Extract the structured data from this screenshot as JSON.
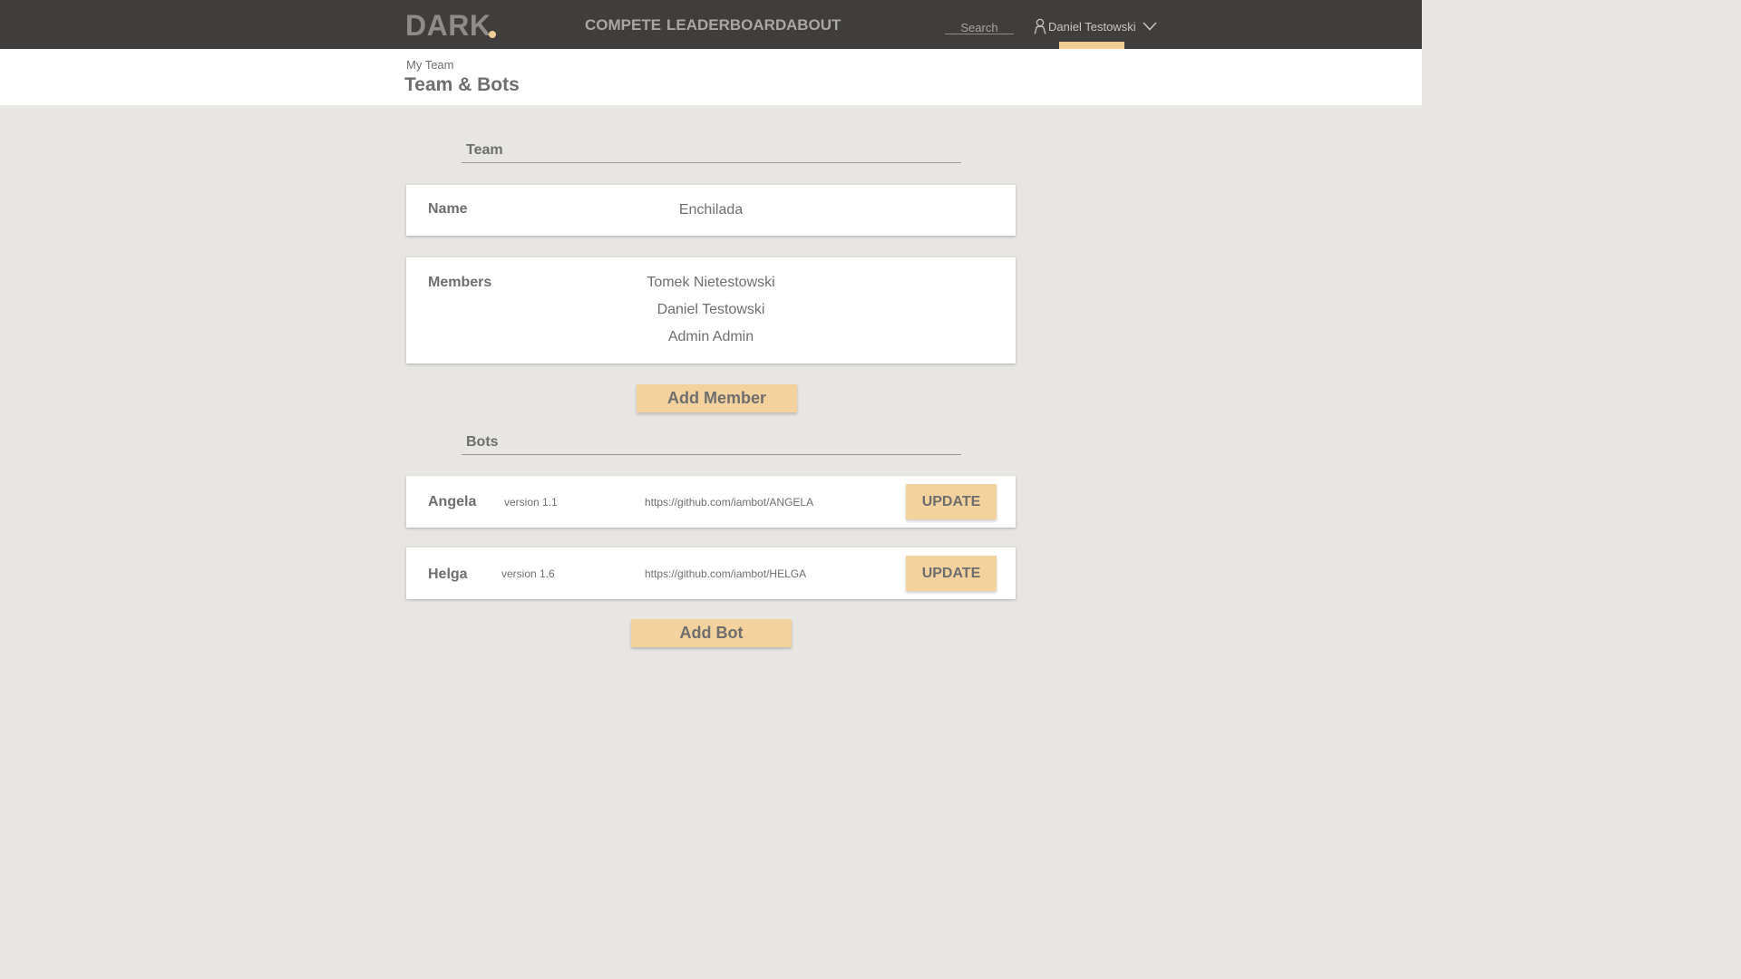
{
  "header": {
    "logo": "DARK",
    "nav": [
      "COMPETE",
      "LEADERBOARD",
      "ABOUT"
    ],
    "search_placeholder": "Search",
    "user_name": "Daniel Testowski"
  },
  "page": {
    "breadcrumb": "My Team",
    "title": "Team & Bots"
  },
  "team_section": {
    "title": "Team",
    "name_label": "Name",
    "name_value": "Enchilada",
    "members_label": "Members",
    "members": [
      "Tomek Nietestowski",
      "Daniel Testowski",
      "Admin Admin"
    ],
    "add_member_label": "Add Member"
  },
  "bots_section": {
    "title": "Bots",
    "bots": [
      {
        "name": "Angela",
        "version": "version 1.1",
        "repo": "https://github.com/iambot/ANGELA",
        "button": "UPDATE"
      },
      {
        "name": "Helga",
        "version": "version 1.6",
        "repo": "https://github.com/iambot/HELGA",
        "button": "UPDATE"
      }
    ],
    "add_bot_label": "Add Bot"
  },
  "colors": {
    "topbar": "#3f3e3c",
    "accent": "#f3d29e",
    "background": "#e8e6e3",
    "text": "#6e6e6e"
  }
}
